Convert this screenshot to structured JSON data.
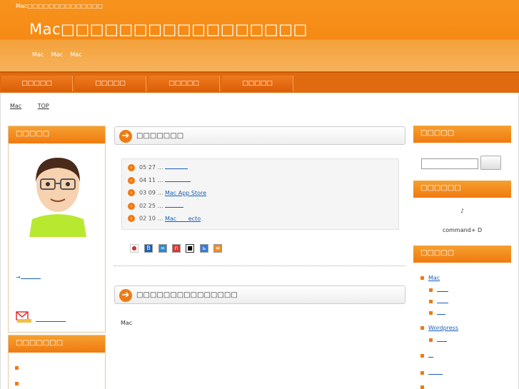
{
  "header": {
    "top_text": "Mac□□□□□□□□□□□□□□",
    "site_title": "Mac□□□□□□□□□□□□□□□□□",
    "description": "Mac Mac Mac"
  },
  "nav": {
    "items": [
      "□□□□□",
      "□□□□□",
      "□□□□□",
      "□□□□□"
    ]
  },
  "breadcrumb": {
    "home": "Mac",
    "current": "TOP"
  },
  "left_sidebar": {
    "profile_title": "□□□□□",
    "profile_link": "→",
    "contact_link": "",
    "category_title": "□□□□□□□",
    "items": [
      "",
      ""
    ]
  },
  "main": {
    "news_title": "□□□□□□□",
    "news": [
      {
        "date": "05 27",
        "sep": "…",
        "link": ""
      },
      {
        "date": "04 11",
        "sep": "…",
        "link": ""
      },
      {
        "date": "03 09",
        "sep": "…",
        "link": "Mac App Store"
      },
      {
        "date": "02 25",
        "sep": "…",
        "link": ""
      },
      {
        "date": "02 10",
        "sep": "…",
        "link": "Mac ecto"
      }
    ],
    "about_title": "□□□□□□□□□□□□□□□",
    "about_text": "Mac"
  },
  "right_sidebar": {
    "search_title": "□□□□□",
    "bookmark_title": "□□□□□□",
    "bookmark_note": "♪",
    "bookmark_shortcut": "command+ D",
    "category_title": "□□□□□",
    "categories": [
      {
        "label": "Mac",
        "level": 0
      },
      {
        "label": "",
        "level": 1
      },
      {
        "label": "",
        "level": 1
      },
      {
        "label": "",
        "level": 1
      },
      {
        "label": "Wordpress",
        "level": 0
      },
      {
        "label": "",
        "level": 1
      },
      {
        "label": "",
        "level": 0
      },
      {
        "label": "",
        "level": 0
      },
      {
        "label": "",
        "level": 1
      }
    ]
  },
  "colors": {
    "accent": "#f07a10",
    "link": "#1a5fb4"
  }
}
